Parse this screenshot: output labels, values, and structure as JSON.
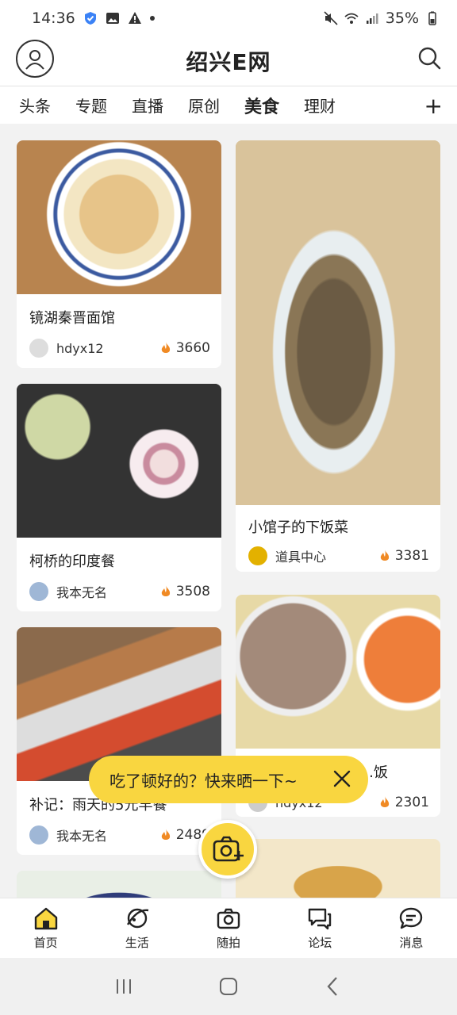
{
  "status_bar": {
    "time": "14:36",
    "battery": "35%"
  },
  "header": {
    "logo": "绍兴E网",
    "profile_icon": "person-icon",
    "search_icon": "search-icon"
  },
  "tabs": [
    "头条",
    "专题",
    "直播",
    "原创",
    "美食",
    "理财"
  ],
  "active_tab": "美食",
  "tab_add": "+",
  "cards": [
    {
      "title": "镜湖秦晋面馆",
      "user": "hdyx12",
      "heat": "3660"
    },
    {
      "title": "小馆子的下饭菜",
      "user": "道具中心",
      "heat": "3381"
    },
    {
      "title": "柯桥的印度餐",
      "user": "我本无名",
      "heat": "3508"
    },
    {
      "title": "…饭",
      "user": "hdyx12",
      "heat": "2301"
    },
    {
      "title": "补记：雨天的5元早餐",
      "user": "我本无名",
      "heat": "2489"
    }
  ],
  "prompt": {
    "text": "吃了顿好的？快来晒一下~"
  },
  "bottom_nav": [
    {
      "label": "首页",
      "icon": "home-icon"
    },
    {
      "label": "生活",
      "icon": "planet-icon"
    },
    {
      "label": "随拍",
      "icon": "camera-icon"
    },
    {
      "label": "论坛",
      "icon": "forum-icon"
    },
    {
      "label": "消息",
      "icon": "message-icon"
    }
  ],
  "colors": {
    "accent": "#f9d640",
    "heat": "#f08a24"
  }
}
